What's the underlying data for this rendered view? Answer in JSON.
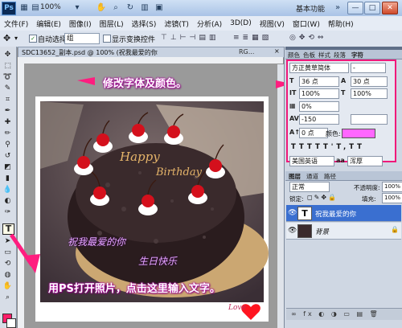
{
  "titlebar": {
    "app_logo": "Ps",
    "zoom_level": "100%",
    "workspace": "基本功能",
    "minimize": "—",
    "maximize": "□",
    "close": "✕"
  },
  "menu": [
    "文件(F)",
    "编辑(E)",
    "图像(I)",
    "图层(L)",
    "选择(S)",
    "滤镜(T)",
    "分析(A)",
    "3D(D)",
    "视图(V)",
    "窗口(W)",
    "帮助(H)"
  ],
  "options": {
    "auto_select_label": "自动选择:",
    "auto_select_value": "组",
    "show_transform_label": "显示变换控件"
  },
  "document": {
    "tab_title": "SDC13652_副本.psd @ 100% (祝我最爱的你",
    "tab_extra": "RG..."
  },
  "annotations": {
    "top": "修改字体及颜色。",
    "bottom": "用PS打开照片，点击这里输入文字。"
  },
  "canvas": {
    "text_line1": "祝我最爱的你",
    "text_line2": "生日快乐",
    "love": "Love"
  },
  "character_panel": {
    "tabs": [
      "颜色",
      "色板",
      "样式",
      "段落",
      "字符"
    ],
    "font_family": "方正黄草简体",
    "font_style": "-",
    "font_size": "36 点",
    "leading": "30 点",
    "vertical_scale": "100%",
    "horizontal_scale": "100%",
    "tsume": "0%",
    "tracking": "-150",
    "baseline_shift": "0 点",
    "color_label": "颜色:",
    "language": "美国英语",
    "antialias": "浑厚"
  },
  "layers_panel": {
    "tabs": [
      "图层",
      "通道",
      "路径"
    ],
    "blend_mode": "正常",
    "opacity_label": "不透明度:",
    "opacity_value": "100%",
    "lock_label": "锁定:",
    "fill_label": "填充:",
    "fill_value": "100%",
    "layers": [
      {
        "name": "祝我最爱的你",
        "thumb": "T"
      },
      {
        "name": "背景",
        "thumb": ""
      }
    ]
  }
}
